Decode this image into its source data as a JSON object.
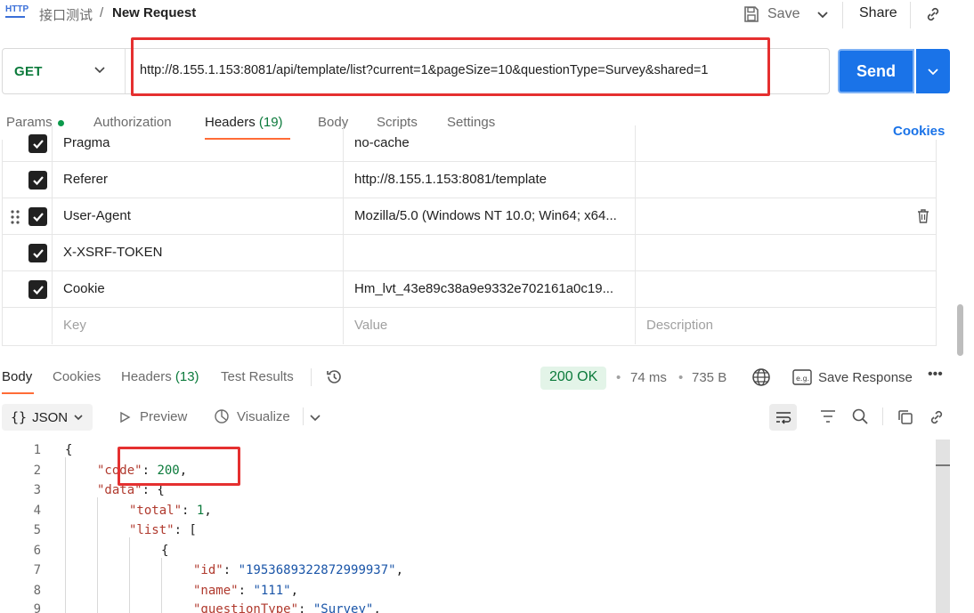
{
  "header": {
    "breadcrumb_parent": "接口测试",
    "breadcrumb_sep": "/",
    "title": "New Request",
    "save_label": "Save",
    "share_label": "Share"
  },
  "request": {
    "method": "GET",
    "url": "http://8.155.1.153:8081/api/template/list?current=1&pageSize=10&questionType=Survey&shared=1",
    "send_label": "Send"
  },
  "request_tabs": {
    "params": "Params",
    "authorization": "Authorization",
    "headers": "Headers",
    "headers_count": "(19)",
    "body": "Body",
    "scripts": "Scripts",
    "settings": "Settings",
    "cookies": "Cookies"
  },
  "headers_rows": [
    {
      "key": "Pragma",
      "value": "no-cache"
    },
    {
      "key": "Referer",
      "value": "http://8.155.1.153:8081/template"
    },
    {
      "key": "User-Agent",
      "value": "Mozilla/5.0 (Windows NT 10.0; Win64; x64..."
    },
    {
      "key": "X-XSRF-TOKEN",
      "value": ""
    },
    {
      "key": "Cookie",
      "value": "Hm_lvt_43e89c38a9e9332e702161a0c19..."
    }
  ],
  "headers_placeholder": {
    "key": "Key",
    "value": "Value",
    "description": "Description"
  },
  "response_tabs": {
    "body": "Body",
    "cookies": "Cookies",
    "headers": "Headers",
    "headers_count": "(13)",
    "test_results": "Test Results"
  },
  "response_meta": {
    "status": "200 OK",
    "time": "74 ms",
    "size": "735 B",
    "save_response": "Save Response"
  },
  "response_toolbar": {
    "format": "JSON",
    "preview": "Preview",
    "visualize": "Visualize"
  },
  "code_lines": [
    {
      "n": "1",
      "text": "{"
    },
    {
      "n": "2",
      "key": "\"code\"",
      "punct": ": ",
      "num": "200",
      "tail": ","
    },
    {
      "n": "3",
      "key": "\"data\"",
      "punct": ": {"
    },
    {
      "n": "4",
      "key": "\"total\"",
      "punct": ": ",
      "num": "1",
      "tail": ","
    },
    {
      "n": "5",
      "key": "\"list\"",
      "punct": ": ["
    },
    {
      "n": "6",
      "text": "{"
    },
    {
      "n": "7",
      "key": "\"id\"",
      "punct": ": ",
      "str": "\"1953689322872999937\"",
      "tail": ","
    },
    {
      "n": "8",
      "key": "\"name\"",
      "punct": ": ",
      "str": "\"111\"",
      "tail": ","
    },
    {
      "n": "9",
      "key": "\"questionType\"",
      "punct": ": ",
      "str": "\"Survey\"",
      "tail": ","
    }
  ],
  "colors": {
    "send": "#1a73e8",
    "accent": "#ff6c37",
    "status_green": "#0b7a3b",
    "highlight_red": "#e53030"
  }
}
